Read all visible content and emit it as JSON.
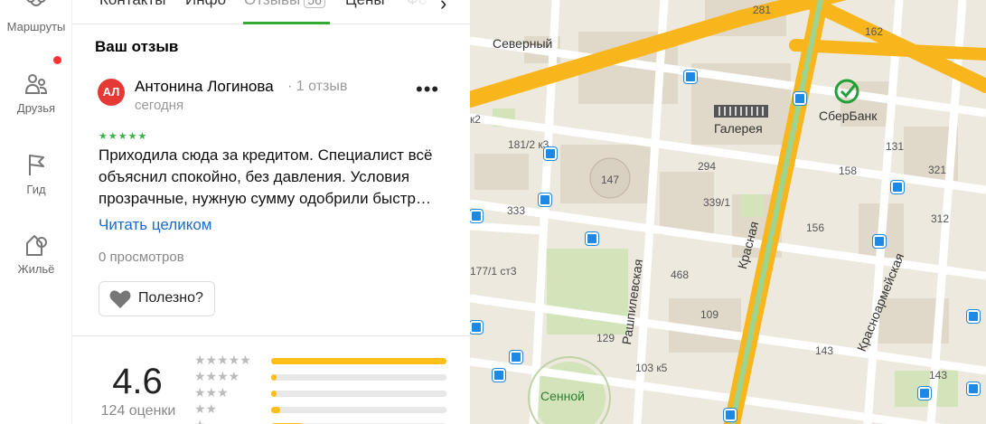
{
  "sidebar": {
    "items": [
      {
        "label": "Маршруты",
        "icon": "route-icon"
      },
      {
        "label": "Друзья",
        "icon": "friends-icon",
        "has_notification": true
      },
      {
        "label": "Гид",
        "icon": "flag-icon"
      },
      {
        "label": "Жильё",
        "icon": "house-icon"
      }
    ]
  },
  "tabs": [
    {
      "label": "Контакты"
    },
    {
      "label": "Инфо"
    },
    {
      "label": "Отзывы",
      "badge": "56",
      "active": true
    },
    {
      "label": "Цены"
    },
    {
      "label": "Фо"
    }
  ],
  "review": {
    "section_title": "Ваш отзыв",
    "avatar_initials": "АЛ",
    "author_name": "Антонина Логинова",
    "author_reviews": "· 1 отзыв",
    "date": "сегодня",
    "rating_stars": 5,
    "stars_text": "★★★★★",
    "text": "Приходила сюда за кредитом. Специалист всё объяснил спокойно, без давления. Условия прозрачные, нужную сумму одобрили быстр…",
    "read_more": "Читать целиком",
    "views": "0 просмотров",
    "helpful_label": "Полезно?",
    "more_label": "•••"
  },
  "rating": {
    "value": "4.6",
    "count": "124 оценки",
    "distribution": [
      {
        "stars": "★★★★★",
        "fraction": 1.0
      },
      {
        "stars": "★★★★",
        "fraction": 0.03
      },
      {
        "stars": "★★★",
        "fraction": 0.02
      },
      {
        "stars": "★★",
        "fraction": 0.05
      },
      {
        "stars": "★",
        "fraction": 0.18
      }
    ]
  },
  "map": {
    "labels": {
      "severny": "Северный",
      "galereya": "Галерея",
      "sberbank": "СберБанк",
      "sennoy": "Сенной",
      "krasnaya": "Красная",
      "rashpilevskaya": "Рашпилевская",
      "krasnoarmeyskaya": "Красноармейская",
      "n281": "281",
      "n162": "162",
      "n131": "131",
      "n158": "158",
      "n321": "321",
      "n294": "294",
      "n339": "339/1",
      "n147": "147",
      "n333": "333",
      "n181": "181/2 к3",
      "k2": "к2",
      "n156": "156",
      "n312": "312",
      "n468": "468",
      "n177": "177/1 ст3",
      "n109": "109",
      "n129": "129",
      "n103": "103 к5",
      "n143a": "143",
      "n143b": "143"
    },
    "colors": {
      "major_road": "#f9b61c",
      "street": "#ffffff",
      "block": "#e6e0d4",
      "park": "#d9e6c3"
    }
  }
}
